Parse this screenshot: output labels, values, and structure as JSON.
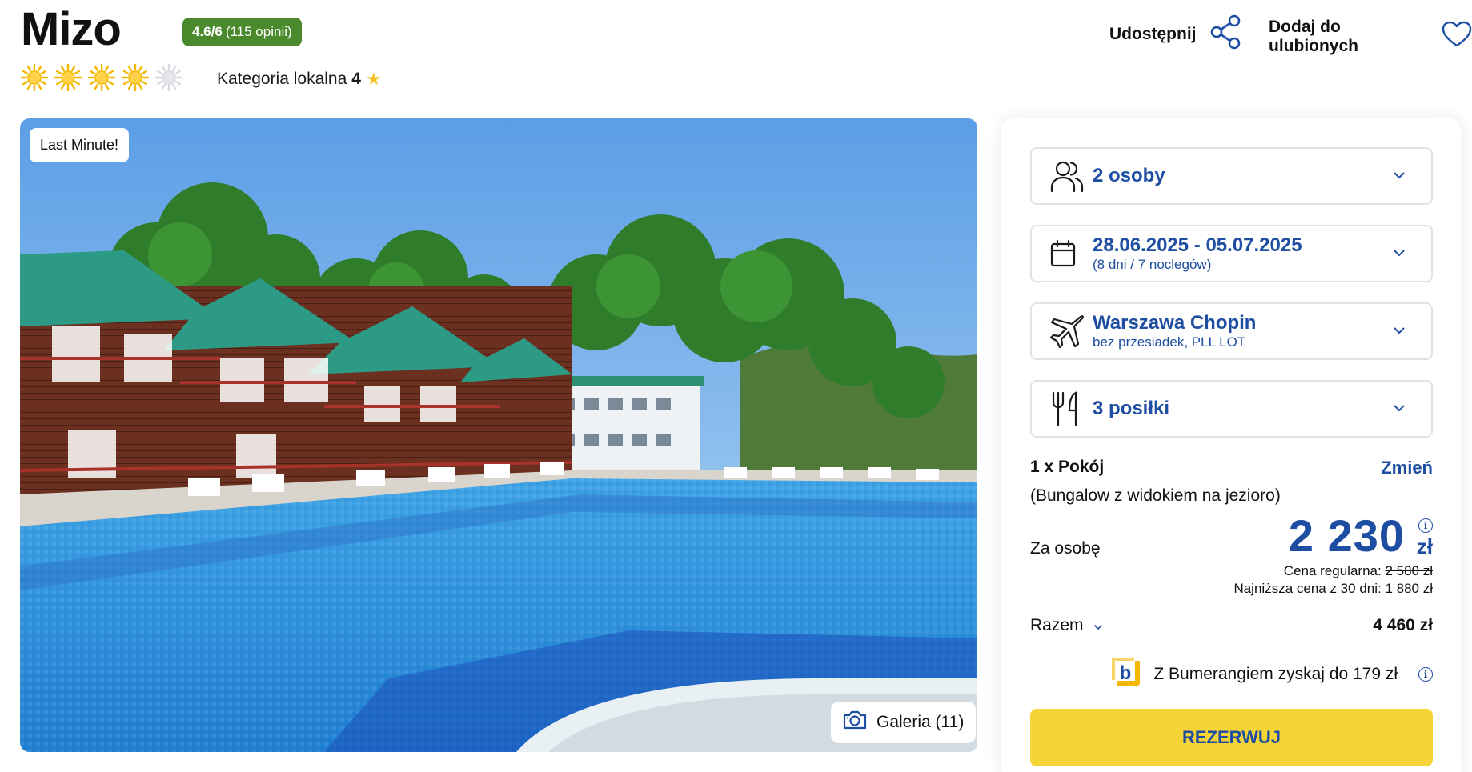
{
  "header": {
    "hotel_name": "Mizo",
    "rating_score": "4.6/6",
    "rating_reviews": "(115 opinii)",
    "suns_filled": 4,
    "suns_total": 5,
    "local_category_label": "Kategoria lokalna",
    "local_category_value": "4",
    "share_label": "Udostępnij",
    "favorite_label": "Dodaj do ulubionych"
  },
  "photo": {
    "badge": "Last Minute!",
    "gallery_label": "Galeria (11)"
  },
  "booking": {
    "travelers": "2 osoby",
    "dates": "28.06.2025 - 05.07.2025",
    "dates_sub": "(8 dni / 7 noclegów)",
    "departure": "Warszawa Chopin",
    "departure_sub": "bez przesiadek, PLL LOT",
    "meals": "3 posiłki",
    "room_count": "1 x Pokój",
    "change_link": "Zmień",
    "room_desc": "(Bungalow z widokiem na jezioro)",
    "per_person_label": "Za osobę",
    "price": "2 230",
    "currency": "zł",
    "regular_price_label": "Cena regularna:",
    "regular_price": "2 580 zł",
    "lowest_price": "Najniższa cena z 30 dni: 1 880 zł",
    "total_label": "Razem",
    "total_value": "4 460 zł",
    "bumerang_text": "Z Bumerangiem zyskaj do 179 zł",
    "reserve_label": "REZERWUJ"
  },
  "icons": {
    "sun": "sun-icon",
    "star": "star-icon",
    "share": "share-icon",
    "heart": "heart-icon",
    "camera": "camera-icon",
    "people": "people-icon",
    "calendar": "calendar-icon",
    "plane": "plane-icon",
    "cutlery": "cutlery-icon",
    "chevron": "chevron-down-icon",
    "info": "info-icon",
    "bumerang": "bumerang-logo-icon"
  },
  "colors": {
    "brand_blue": "#1e4ea1",
    "rating_green": "#4a8a2c",
    "sun_yellow": "#f5b800",
    "reserve_yellow": "#f7d436"
  }
}
